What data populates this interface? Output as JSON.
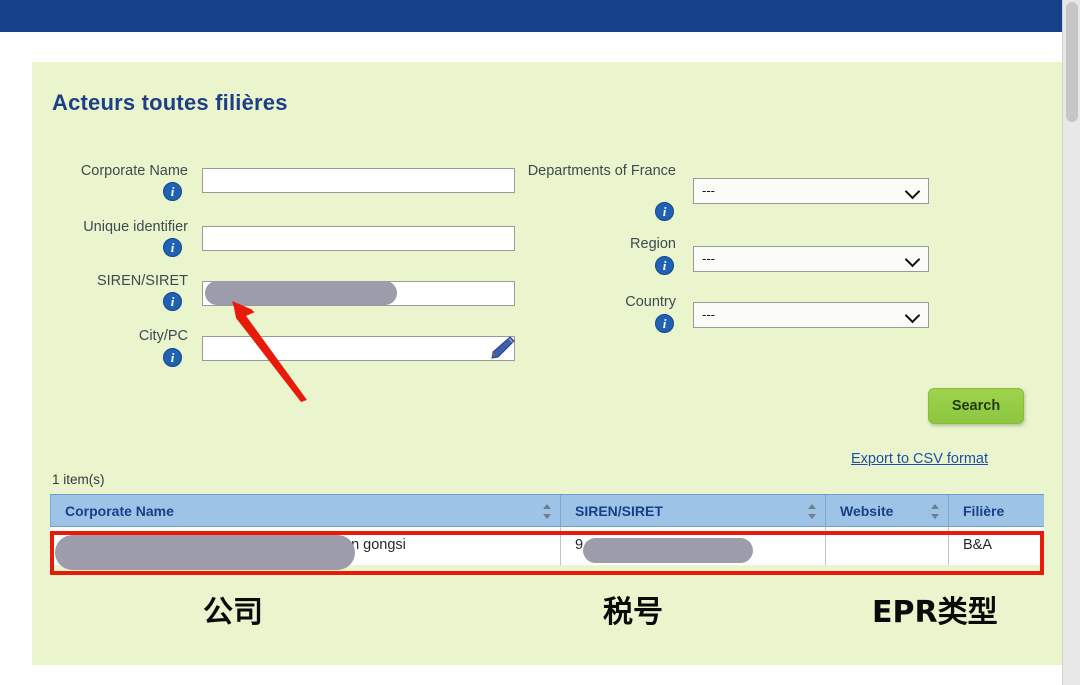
{
  "window": {
    "topbar_color": "#17408b",
    "panel_color": "#eaf5cd"
  },
  "page_title": "Acteurs toutes filières",
  "form": {
    "left_fields": [
      {
        "label": "Corporate Name",
        "icon": "info-icon",
        "value": "",
        "type": "text"
      },
      {
        "label": "Unique identifier",
        "icon": "info-icon",
        "value": "",
        "type": "text"
      },
      {
        "label": "SIREN/SIRET",
        "icon": "info-icon",
        "value": "",
        "type": "text",
        "redacted": true
      },
      {
        "label": "City/PC",
        "icon": "info-icon",
        "value": "",
        "type": "text",
        "trailing_icon": "pencil-icon"
      }
    ],
    "right_fields": [
      {
        "label": "Departments of France",
        "icon": "info-icon",
        "value": "---",
        "type": "select"
      },
      {
        "label": "Region",
        "icon": "info-icon",
        "value": "---",
        "type": "select"
      },
      {
        "label": "Country",
        "icon": "info-icon",
        "value": "---",
        "type": "select"
      }
    ],
    "search_button": "Search",
    "export_link": "Export to CSV format"
  },
  "results": {
    "count_label": "1 item(s)",
    "columns": [
      {
        "label": "Corporate Name",
        "sortable": true
      },
      {
        "label": "SIREN/SIRET",
        "sortable": true
      },
      {
        "label": "Website",
        "sortable": true
      },
      {
        "label": "Filière",
        "sortable": false
      }
    ],
    "rows": [
      {
        "corporate_name": "an gongsi",
        "siren_siret": "9",
        "website": "",
        "filiere": "B&A"
      }
    ]
  },
  "annotations": {
    "arrow_color": "#e81b0b",
    "box_color": "#e81b0b",
    "labels": [
      {
        "text": "公司",
        "meaning": "company"
      },
      {
        "text": "税号",
        "meaning": "tax-number"
      },
      {
        "text": "EPR类型",
        "meaning": "epr-type"
      }
    ]
  }
}
